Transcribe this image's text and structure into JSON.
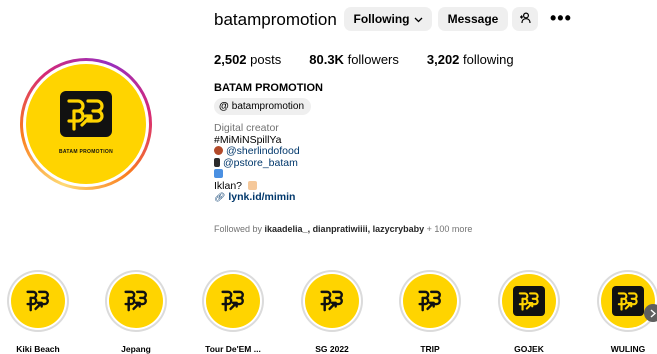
{
  "profile": {
    "username": "batampromotion",
    "following_button": "Following",
    "message_button": "Message",
    "more": "•••",
    "stats": {
      "posts_count": "2,502",
      "posts_label": "posts",
      "followers_count": "80.3K",
      "followers_label": "followers",
      "following_count": "3,202",
      "following_label": "following"
    },
    "full_name": "BATAM PROMOTION",
    "threads_handle": "batampromotion",
    "avatar_caption": "BATAM PROMOTION",
    "category": "Digital creator",
    "bio_lines": {
      "line1": "#MiMiNSpillYa",
      "line2": "@sherlindofood",
      "line3": "@pstore_batam",
      "line4": "Iklan?",
      "website": "lynk.id/mimin"
    },
    "followed_by": {
      "prefix": "Followed by ",
      "names": "ikaadelia_, dianpratiwiiii, lazycrybaby",
      "suffix": " + 100 more"
    }
  },
  "highlights": [
    {
      "label": "Kiki Beach"
    },
    {
      "label": "Jepang"
    },
    {
      "label": "Tour De'EM ..."
    },
    {
      "label": "SG 2022"
    },
    {
      "label": "TRIP"
    },
    {
      "label": "GOJEK"
    },
    {
      "label": "WULING"
    }
  ],
  "colors": {
    "brand_yellow": "#ffd400",
    "link_blue": "#00376b",
    "button_gray": "#efefef",
    "muted_text": "#737373"
  },
  "icons": {
    "following_chevron": "chevron-down-icon",
    "add_person": "add-person-icon",
    "more": "more-horizontal-icon",
    "threads": "threads-icon",
    "link": "link-icon",
    "scroll_next": "chevron-right-icon"
  }
}
